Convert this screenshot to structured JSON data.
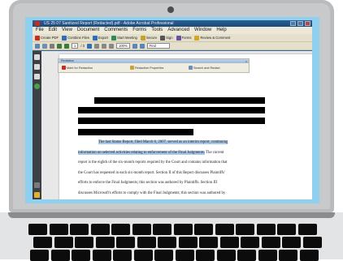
{
  "window": {
    "title": "US 25 07 Sanitized Report (Redacted).pdf - Adobe Acrobat Professional"
  },
  "menubar": [
    "File",
    "Edit",
    "View",
    "Document",
    "Comments",
    "Forms",
    "Tools",
    "Advanced",
    "Window",
    "Help"
  ],
  "toolbar1": [
    {
      "label": "Create PDF",
      "icon": "create-pdf-icon",
      "color": "#c52b1e"
    },
    {
      "label": "Combine Files",
      "icon": "combine-files-icon",
      "color": "#2f6db5"
    },
    {
      "label": "Export",
      "icon": "export-icon",
      "color": "#2f6db5"
    },
    {
      "label": "Start Meeting",
      "icon": "start-meeting-icon",
      "color": "#2e8b57"
    },
    {
      "label": "Secure",
      "icon": "secure-icon",
      "color": "#c7a12a"
    },
    {
      "label": "Sign",
      "icon": "sign-icon",
      "color": "#555555"
    },
    {
      "label": "Forms",
      "icon": "forms-icon",
      "color": "#6b4fa0"
    },
    {
      "label": "Review & Comment",
      "icon": "review-comment-icon",
      "color": "#d8a520"
    }
  ],
  "toolbar2": {
    "page_current": "1",
    "page_total": "/ 3",
    "zoom": "100%",
    "find_placeholder": "Find"
  },
  "redaction_toolbar": {
    "title": "Redaction",
    "mark_label": "Mark for Redaction",
    "apply_label": "Redaction Properties",
    "search_label": "Search and Redact"
  },
  "document": {
    "lines": [
      {
        "text": "The last Status Report, filed March 6, 2007, served as an interim report, continuing",
        "highlight": true,
        "indent": true
      },
      {
        "text": "information on selected activities relating to enforcement of the Final Judgments.",
        "highlight": true,
        "tail": "  The current"
      },
      {
        "text": "report is the eighth of the six-month reports required by the Court and contains information that",
        "highlight": false
      },
      {
        "text": "the Court has requested in each six-month report.  Section II of this Report discusses Plaintiffs'",
        "highlight": false
      },
      {
        "text": "efforts to enforce the Final Judgments; this section was authored by Plaintiffs.  Section III",
        "highlight": false
      },
      {
        "text": "discusses Microsoft's efforts to comply with the Final Judgments; this section was authored by",
        "highlight": false
      }
    ]
  },
  "colors": {
    "screen_glow": "#8fd0ee",
    "highlight": "#a9c8e8",
    "redaction": "#000000"
  }
}
